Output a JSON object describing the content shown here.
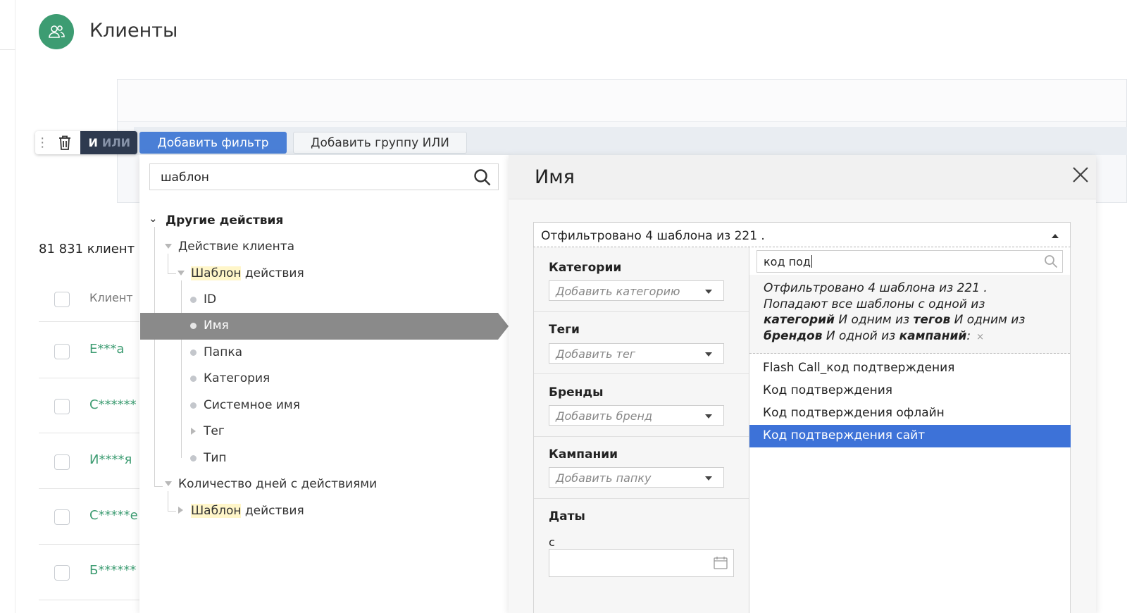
{
  "header": {
    "title": "Клиенты",
    "icon": "users-icon",
    "icon_color": "#3d9c72"
  },
  "toolbar": {
    "drag_icon": "drag-handle-icon",
    "trash_icon": "trash-icon",
    "and_label": "И",
    "or_label": "ИЛИ",
    "add_filter_label": "Добавить фильтр",
    "add_group_label": "Добавить группу ИЛИ"
  },
  "clients": {
    "count_label": "81 831 клиент",
    "column_header": "Клиент",
    "rows": [
      "Е***а",
      "С******",
      "И****я",
      "С*****е",
      "Б******"
    ]
  },
  "tree": {
    "search_value": "шаблон",
    "items": [
      {
        "label": "Другие действия"
      },
      {
        "label": "Действие клиента"
      },
      {
        "hl": "Шаблон",
        "rest": " действия"
      },
      {
        "label": "ID"
      },
      {
        "label": "Имя"
      },
      {
        "label": "Папка"
      },
      {
        "label": "Категория"
      },
      {
        "label": "Системное имя"
      },
      {
        "label": "Тег"
      },
      {
        "label": "Тип"
      },
      {
        "label": "Количество дней с действиями"
      },
      {
        "hl": "Шаблон",
        "rest": " действия"
      }
    ]
  },
  "detail": {
    "title": "Имя",
    "select_summary": "Отфильтровано 4 шаблона из 221 .",
    "filters": [
      {
        "label": "Категории",
        "placeholder": "Добавить категорию"
      },
      {
        "label": "Теги",
        "placeholder": "Добавить тег"
      },
      {
        "label": "Бренды",
        "placeholder": "Добавить бренд"
      },
      {
        "label": "Кампании",
        "placeholder": "Добавить папку"
      }
    ],
    "dates_label": "Даты",
    "date_from_label": "с",
    "dropdown": {
      "search_value": "код под",
      "info_line1": "Отфильтровано 4 шаблона из 221 .",
      "info_p1": "Попадают все шаблоны с одной из ",
      "info_b1": "категорий",
      "info_p2": " И одним из ",
      "info_b2": "тегов",
      "info_p3": " И одним из ",
      "info_b3": "брендов",
      "info_p4": " И одной из ",
      "info_b4": "кампаний",
      "info_p5": ":",
      "info_clear": "×",
      "options": [
        {
          "label": "Flash Call_код подтверждения",
          "active": false
        },
        {
          "label": "Код подтверждения",
          "active": false
        },
        {
          "label": "Код подтверждения офлайн",
          "active": false
        },
        {
          "label": "Код подтверждения сайт",
          "active": true
        }
      ],
      "active_color": "#3d72d8"
    }
  }
}
